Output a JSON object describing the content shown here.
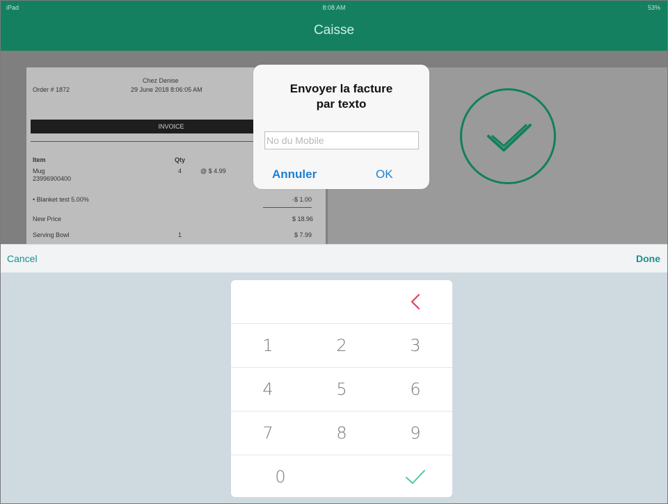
{
  "status_bar": {
    "carrier": "iPad",
    "time": "8:08 AM",
    "battery": "53%"
  },
  "nav": {
    "title": "Caisse"
  },
  "invoice": {
    "store": "Chez Denise",
    "order": "Order # 1872",
    "date": "29 June 2018 8:06:05 AM",
    "heading": "INVOICE",
    "col_item": "Item",
    "col_qty": "Qty",
    "rows": [
      {
        "name": "Mug",
        "sku": "23996900400",
        "qty": "4",
        "unit": "@ $ 4.99",
        "amount": ""
      },
      {
        "name": "• Blanket test 5.00%",
        "sku": "",
        "qty": "",
        "unit": "",
        "amount": "-$ 1.00"
      },
      {
        "name": "New Price",
        "sku": "",
        "qty": "",
        "unit": "",
        "amount": "$ 18.96"
      },
      {
        "name": "Serving Bowl",
        "sku": "",
        "qty": "1",
        "unit": "",
        "amount": "$ 7.99"
      }
    ]
  },
  "alert": {
    "title_line1": "Envoyer la facture",
    "title_line2": "par texto",
    "input_placeholder": "No du Mobile",
    "input_value": "",
    "cancel_label": "Annuler",
    "ok_label": "OK"
  },
  "toolbar": {
    "cancel_label": "Cancel",
    "done_label": "Done"
  },
  "keypad": {
    "keys": [
      "1",
      "2",
      "3",
      "4",
      "5",
      "6",
      "7",
      "8",
      "9",
      "0"
    ],
    "backspace_icon": "chevron-left-icon",
    "confirm_icon": "checkmark-icon",
    "backspace_color": "#e0425f",
    "confirm_color": "#4cc99a"
  },
  "colors": {
    "brand": "#14805f",
    "link": "#1d7fd3",
    "toolbar_link": "#1b8f8a"
  }
}
